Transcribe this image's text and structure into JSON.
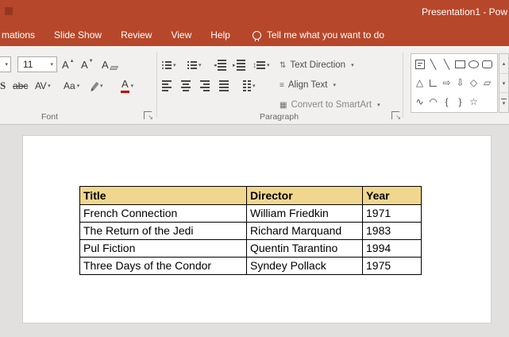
{
  "colors": {
    "titlebar": "#b7472a",
    "ribbon_bg": "#f1f0ee",
    "table_header_bg": "#f1d78e",
    "font_color_red": "#c00000"
  },
  "titlebar": {
    "title": "Presentation1 - Pow"
  },
  "tabs": {
    "items": [
      {
        "label": "mations"
      },
      {
        "label": "Slide Show"
      },
      {
        "label": "Review"
      },
      {
        "label": "View"
      },
      {
        "label": "Help"
      }
    ],
    "tell_me": "Tell me what you want to do"
  },
  "ribbon": {
    "font_group": {
      "label": "Font",
      "font_size": "11",
      "letter": "A",
      "shadow_label": "S",
      "strike_label": "abc",
      "spacing_label": "AV",
      "case_label": "Aa",
      "color_label": "A"
    },
    "paragraph_group": {
      "label": "Paragraph",
      "text_direction": "Text Direction",
      "align_text": "Align Text",
      "convert_smartart": "Convert to SmartArt"
    }
  },
  "icons": {
    "dropdown": "▾",
    "up_small": "▲",
    "down_small": "▼",
    "scroll_up": "▴",
    "scroll_down": "▾",
    "launcher_arrow": "↘",
    "updown_arrow": "↕",
    "text_direction": "⇅",
    "align_text": "≡",
    "smartart": "▦",
    "indent_left": "◂",
    "indent_right": "▸",
    "line": "╲",
    "triangle": "△",
    "block_arrow_right": "⇨",
    "block_arrow_down": "⇩",
    "diamond": "◇",
    "parallelogram": "▱",
    "curve": "∿",
    "arc": "◠",
    "brace_left": "{",
    "brace_right": "}",
    "star": "☆"
  },
  "slide": {
    "table": {
      "headers": [
        "Title",
        "Director",
        "Year"
      ],
      "rows": [
        [
          "French Connection",
          "William Friedkin",
          "1971"
        ],
        [
          "The Return of the Jedi",
          "Richard Marquand",
          "1983"
        ],
        [
          "Pul Fiction",
          "Quentin Tarantino",
          "1994"
        ],
        [
          "Three Days of the Condor",
          "Syndey Pollack",
          "1975"
        ]
      ]
    }
  }
}
